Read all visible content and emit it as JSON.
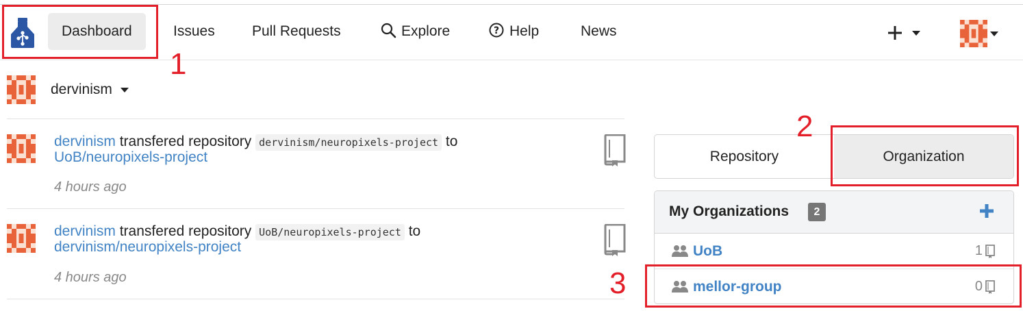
{
  "navbar": {
    "items": [
      {
        "label": "Dashboard",
        "active": true
      },
      {
        "label": "Issues"
      },
      {
        "label": "Pull Requests"
      },
      {
        "label": "Explore",
        "icon": "search-icon"
      },
      {
        "label": "Help",
        "icon": "help-icon"
      },
      {
        "label": "News"
      }
    ],
    "plus_icon": "plus-icon",
    "user_icon": "avatar"
  },
  "context": {
    "username": "dervinism"
  },
  "feed": [
    {
      "user": "dervinism",
      "action": "transfered repository",
      "from_repo": "dervinism/neuropixels-project",
      "to_word": "to",
      "to_repo": "UoB/neuropixels-project",
      "time": "4 hours ago"
    },
    {
      "user": "dervinism",
      "action": "transfered repository",
      "from_repo": "UoB/neuropixels-project",
      "to_word": "to",
      "to_repo": "dervinism/neuropixels-project",
      "time": "4 hours ago"
    }
  ],
  "sidebar": {
    "tabs": [
      {
        "label": "Repository"
      },
      {
        "label": "Organization",
        "active": true
      }
    ],
    "orgs": {
      "title": "My Organizations",
      "count": "2",
      "items": [
        {
          "name": "UoB",
          "repo_count": "1"
        },
        {
          "name": "mellor-group",
          "repo_count": "0"
        }
      ]
    }
  },
  "annotations": [
    "1",
    "2",
    "3"
  ],
  "colors": {
    "link": "#4183c4",
    "accent_red": "#e3202a",
    "logo_blue": "#2b57a5",
    "avatar_orange": "#e8623a"
  }
}
